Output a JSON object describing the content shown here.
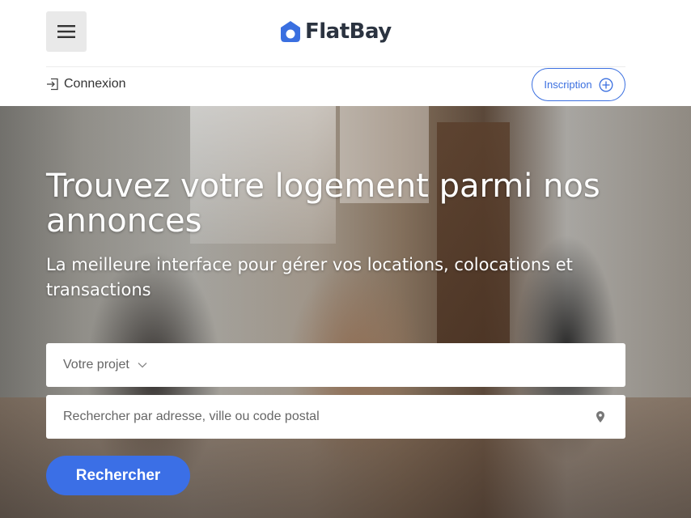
{
  "header": {
    "menu_icon": "hamburger-icon",
    "logo_icon": "house-logo-icon",
    "logo_text": "FlatBay",
    "brand_color": "#3a6fe0"
  },
  "auth": {
    "login_icon": "login-icon",
    "login_label": "Connexion",
    "signup_label": "Inscription",
    "signup_icon": "plus-circle-icon"
  },
  "hero": {
    "title": "Trouvez votre logement parmi nos annonces",
    "subtitle": "La meilleure interface pour gérer vos locations, colocations et transactions",
    "project_select": {
      "placeholder": "Votre projet",
      "icon": "chevron-down-icon"
    },
    "search": {
      "placeholder": "Rechercher par adresse, ville ou code postal",
      "icon": "location-pin-icon"
    },
    "submit_label": "Rechercher"
  }
}
